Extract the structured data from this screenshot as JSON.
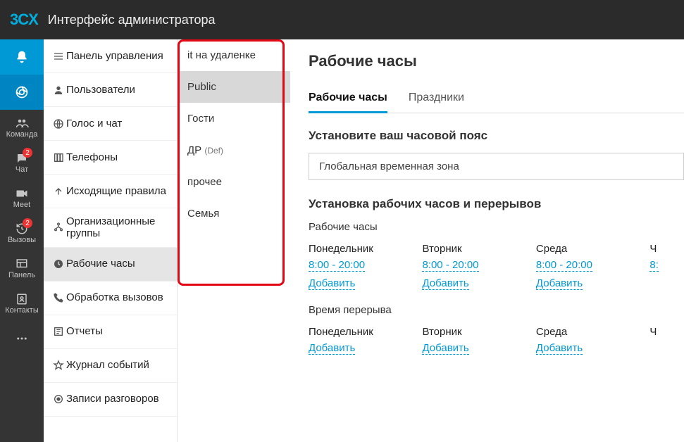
{
  "header": {
    "logo_text": "3CX",
    "title": "Интерфейс администратора"
  },
  "rail": {
    "items": [
      {
        "name": "notifications",
        "label": "",
        "icon": "bell"
      },
      {
        "name": "browser",
        "label": "",
        "icon": "chrome"
      },
      {
        "name": "team",
        "label": "Команда",
        "icon": "users"
      },
      {
        "name": "chat",
        "label": "Чат",
        "icon": "chat",
        "badge": "2"
      },
      {
        "name": "meet",
        "label": "Meet",
        "icon": "video"
      },
      {
        "name": "calls",
        "label": "Вызовы",
        "icon": "history",
        "badge": "2"
      },
      {
        "name": "panel",
        "label": "Панель",
        "icon": "panel"
      },
      {
        "name": "contacts",
        "label": "Контакты",
        "icon": "contacts"
      },
      {
        "name": "more",
        "label": "",
        "icon": "dots"
      }
    ]
  },
  "sidebar": {
    "items": [
      {
        "id": "dashboard",
        "label": "Панель управления",
        "icon": "menu"
      },
      {
        "id": "users",
        "label": "Пользователи",
        "icon": "user"
      },
      {
        "id": "voice",
        "label": "Голос и чат",
        "icon": "globe"
      },
      {
        "id": "phones",
        "label": "Телефоны",
        "icon": "columns"
      },
      {
        "id": "outbound",
        "label": "Исходящие правила",
        "icon": "upload"
      },
      {
        "id": "groups",
        "label": "Организационные группы",
        "icon": "org"
      },
      {
        "id": "workhours",
        "label": "Рабочие часы",
        "icon": "clock",
        "selected": true
      },
      {
        "id": "callhandling",
        "label": "Обработка вызовов",
        "icon": "phone"
      },
      {
        "id": "reports",
        "label": "Отчеты",
        "icon": "reports"
      },
      {
        "id": "events",
        "label": "Журнал событий",
        "icon": "star"
      },
      {
        "id": "recordings",
        "label": "Записи разговоров",
        "icon": "record"
      }
    ]
  },
  "groups": {
    "items": [
      {
        "label": "it на удаленке"
      },
      {
        "label": "Public",
        "selected": true
      },
      {
        "label": "Гости"
      },
      {
        "label": "ДР",
        "suffix": "(Def)"
      },
      {
        "label": "прочее"
      },
      {
        "label": "Семья"
      }
    ]
  },
  "main": {
    "title": "Рабочие часы",
    "tabs": [
      {
        "id": "hours",
        "label": "Рабочие часы",
        "active": true
      },
      {
        "id": "holidays",
        "label": "Праздники"
      }
    ],
    "tz_section_title": "Установите ваш часовой пояс",
    "tz_value": "Глобальная временная зона",
    "sched_section_title": "Установка рабочих часов и перерывов",
    "work_label": "Рабочие часы",
    "break_label": "Время перерыва",
    "add_label": "Добавить",
    "days": [
      {
        "name": "Понедельник",
        "time": "8:00 - 20:00"
      },
      {
        "name": "Вторник",
        "time": "8:00 - 20:00"
      },
      {
        "name": "Среда",
        "time": "8:00 - 20:00"
      },
      {
        "name": "Ч",
        "time": "8:",
        "cut": true
      }
    ]
  }
}
